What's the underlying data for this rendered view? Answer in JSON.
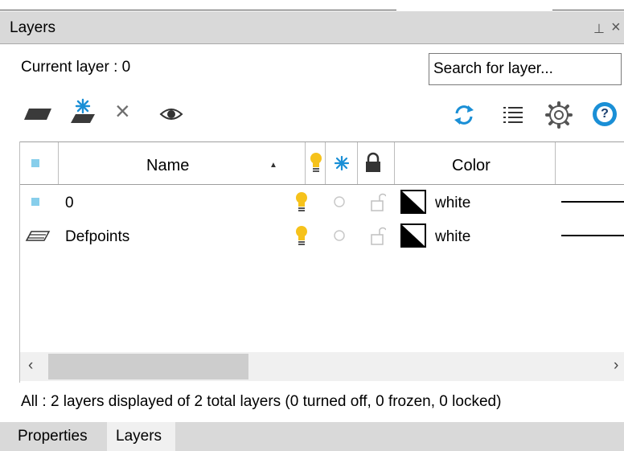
{
  "panel": {
    "title": "Layers",
    "pin_glyph": "⊥",
    "close_glyph": "×"
  },
  "current_layer": {
    "label": "Current layer : 0"
  },
  "search": {
    "placeholder": "Search for layer..."
  },
  "toolbar": {
    "new_layer_icon": "new-layer-icon",
    "new_layer_frozen_icon": "new-layer-frozen-vp-icon",
    "delete_layer_icon": "delete-icon",
    "isolate_icon": "eye-icon",
    "refresh_icon": "refresh-icon",
    "list_icon": "list-icon",
    "settings_icon": "gear-icon",
    "help_icon": "help-icon",
    "help_glyph": "?",
    "delete_glyph": "×"
  },
  "grid": {
    "columns": {
      "name": "Name",
      "sort_arrow": "▲",
      "color": "Color"
    },
    "rows": [
      {
        "name": "0",
        "color": "white",
        "on": true,
        "frozen": false,
        "locked": false,
        "current": true
      },
      {
        "name": "Defpoints",
        "color": "white",
        "on": true,
        "frozen": false,
        "locked": false,
        "current": false
      }
    ]
  },
  "scrollbar": {
    "left_arrow": "‹",
    "right_arrow": "›"
  },
  "status": "All : 2 layers displayed of 2 total layers (0 turned off, 0 frozen, 0 locked)",
  "tabs": [
    {
      "label": "Properties",
      "active": false
    },
    {
      "label": "Layers",
      "active": true
    }
  ],
  "colors": {
    "accent_blue": "#1a8fd6",
    "bulb_yellow": "#f6c21b",
    "current_square": "#87ceeb"
  }
}
